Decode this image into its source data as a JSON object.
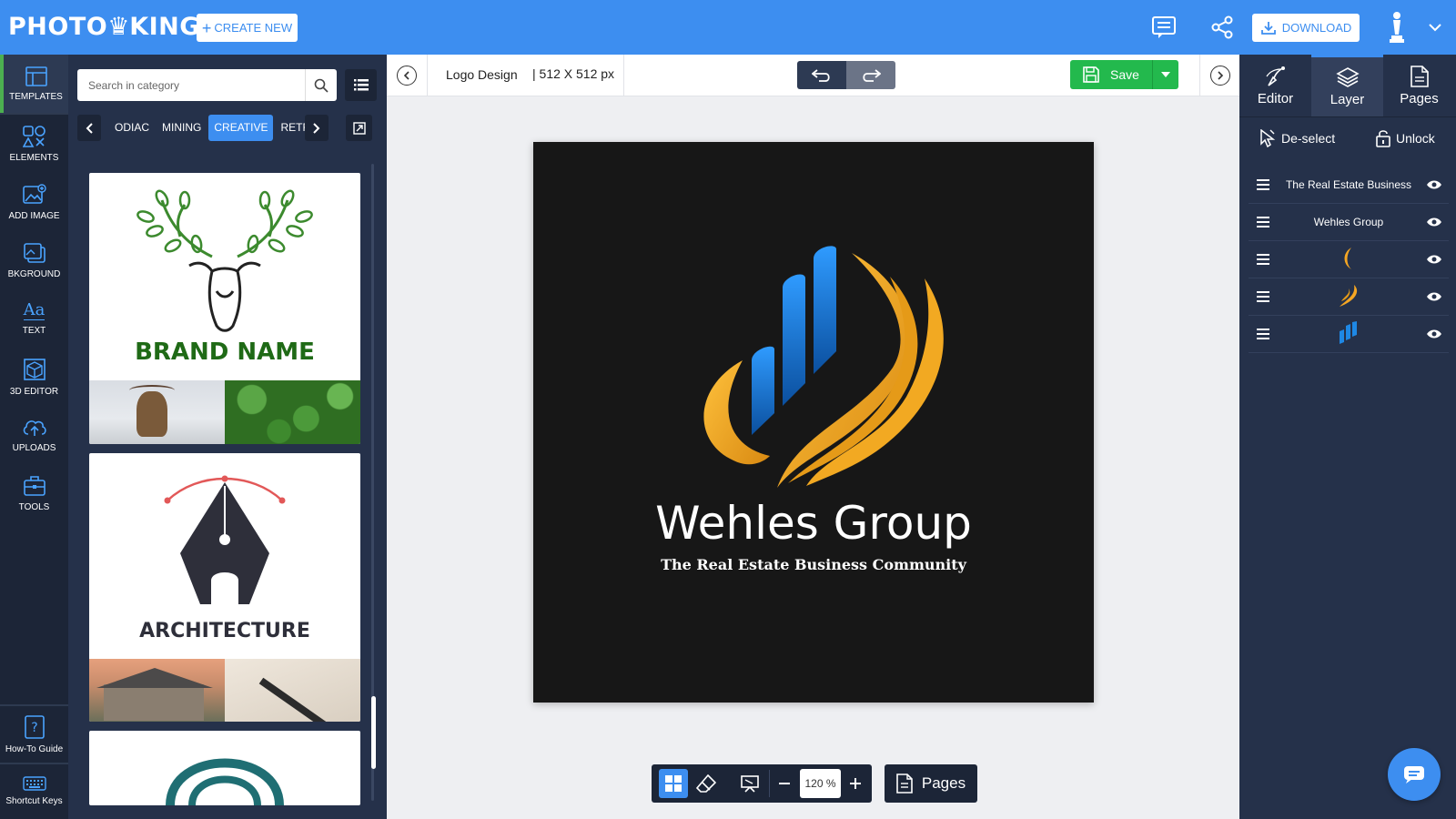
{
  "app": {
    "brand_left": "PHOTO",
    "brand_right": "KING"
  },
  "header": {
    "create_new_label": "CREATE NEW",
    "download_label": "DOWNLOAD",
    "icons": [
      "comments-icon",
      "share-icon",
      "download-icon",
      "user-avatar-icon",
      "chevron-down-icon"
    ]
  },
  "rail": {
    "items": [
      {
        "label": "TEMPLATES",
        "icon": "templates-icon",
        "active": true
      },
      {
        "label": "ELEMENTS",
        "icon": "elements-icon"
      },
      {
        "label": "ADD IMAGE",
        "icon": "add-image-icon"
      },
      {
        "label": "BKGROUND",
        "icon": "background-icon"
      },
      {
        "label": "TEXT",
        "icon": "text-icon"
      },
      {
        "label": "3D EDITOR",
        "icon": "3d-editor-icon"
      },
      {
        "label": "UPLOADS",
        "icon": "upload-icon"
      },
      {
        "label": "TOOLS",
        "icon": "tools-icon"
      }
    ],
    "bottom": [
      {
        "label": "How-To Guide",
        "icon": "help-icon"
      },
      {
        "label": "Shortcut Keys",
        "icon": "keyboard-icon"
      }
    ]
  },
  "categories": {
    "search_placeholder": "Search in category",
    "tabs": [
      "ODIAC",
      "MINING",
      "CREATIVE",
      "RETRO"
    ],
    "active_tab": "CREATIVE",
    "cards": [
      {
        "brand_text": "BRAND NAME"
      },
      {
        "brand_text": "ARCHITECTURE"
      },
      {
        "brand_text": ""
      }
    ]
  },
  "toolbar": {
    "doc_title": "Logo Design",
    "doc_size": "| 512 X 512 px",
    "save_label": "Save"
  },
  "design": {
    "title": "Wehles Group",
    "subtitle": "The Real Estate Business Community",
    "background": "#171717",
    "colors": {
      "blue": "#1e88e5",
      "gold": "#f5a623"
    }
  },
  "bottom_bar": {
    "zoom": "120 %",
    "pages_label": "Pages"
  },
  "right_panel": {
    "tabs": [
      {
        "label": "Editor",
        "icon": "editor-pen-icon"
      },
      {
        "label": "Layer",
        "icon": "layers-icon",
        "active": true
      },
      {
        "label": "Pages",
        "icon": "pages-icon"
      }
    ],
    "deselect_label": "De-select",
    "unlock_label": "Unlock",
    "layers": [
      {
        "name": "The Real Estate Business",
        "type": "text"
      },
      {
        "name": "Wehles Group",
        "type": "text"
      },
      {
        "name": "",
        "type": "shape-gold-left"
      },
      {
        "name": "",
        "type": "shape-gold-right"
      },
      {
        "name": "",
        "type": "shape-blue-bars"
      }
    ]
  },
  "colors": {
    "topbar": "#3d8ef0",
    "rail": "#1c2537",
    "panel": "#25314a",
    "save": "#23b94d"
  }
}
